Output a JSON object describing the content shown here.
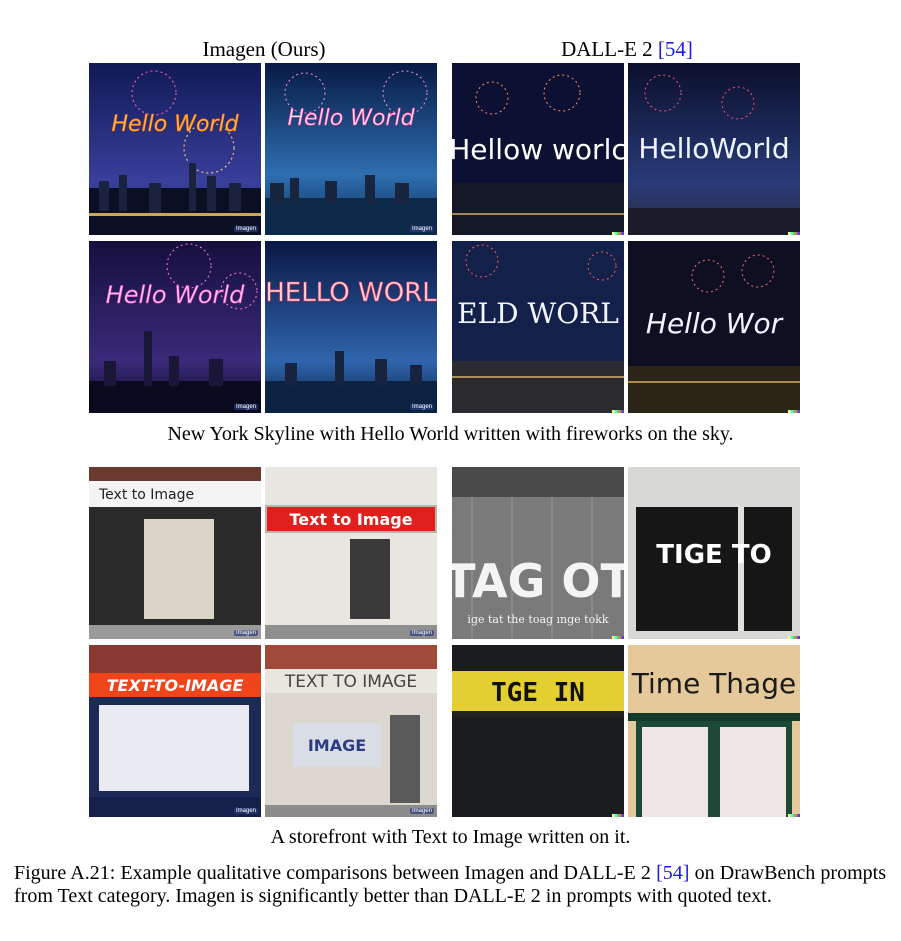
{
  "headers": {
    "imagen": "Imagen (Ours)",
    "dalle_name": "DALL-E 2 ",
    "dalle_cite": "[54]"
  },
  "panels": [
    {
      "caption": "New York Skyline with Hello World written with fireworks on the sky.",
      "imagen": [
        "Hello World",
        "Hello World",
        "Hello World",
        "HELLO WORL"
      ],
      "dalle": [
        "Hellow worlc",
        "HelloWorld",
        "ELD WORL",
        "Hello Wor"
      ]
    },
    {
      "caption": "A storefront with Text to Image written on it.",
      "imagen": [
        "Text to Image",
        "Text to Image",
        "TEXT-TO-IMAGE",
        "TEXT TO IMAGE"
      ],
      "imagen_extra": "IMAGE",
      "dalle": [
        "TAG OT",
        "TIGE  TO",
        "TGE   IN",
        "Time Thage"
      ],
      "dalle_extra": "ige tat  the toag  ınge tokk"
    }
  ],
  "watermark": "Imagen",
  "figure_caption": {
    "p1": "Figure A.21: Example qualitative comparisons between Imagen and DALL-E 2 ",
    "cite": "[54]",
    "p2": " on DrawBench prompts from Text category. Imagen is significantly better than DALL-E 2 in prompts with quoted text."
  },
  "colors": {
    "cite": "#1a1aee",
    "neon_pink": "#ff6ec7",
    "neon_orange": "#ffb347",
    "storefront_red": "#e0201c"
  }
}
